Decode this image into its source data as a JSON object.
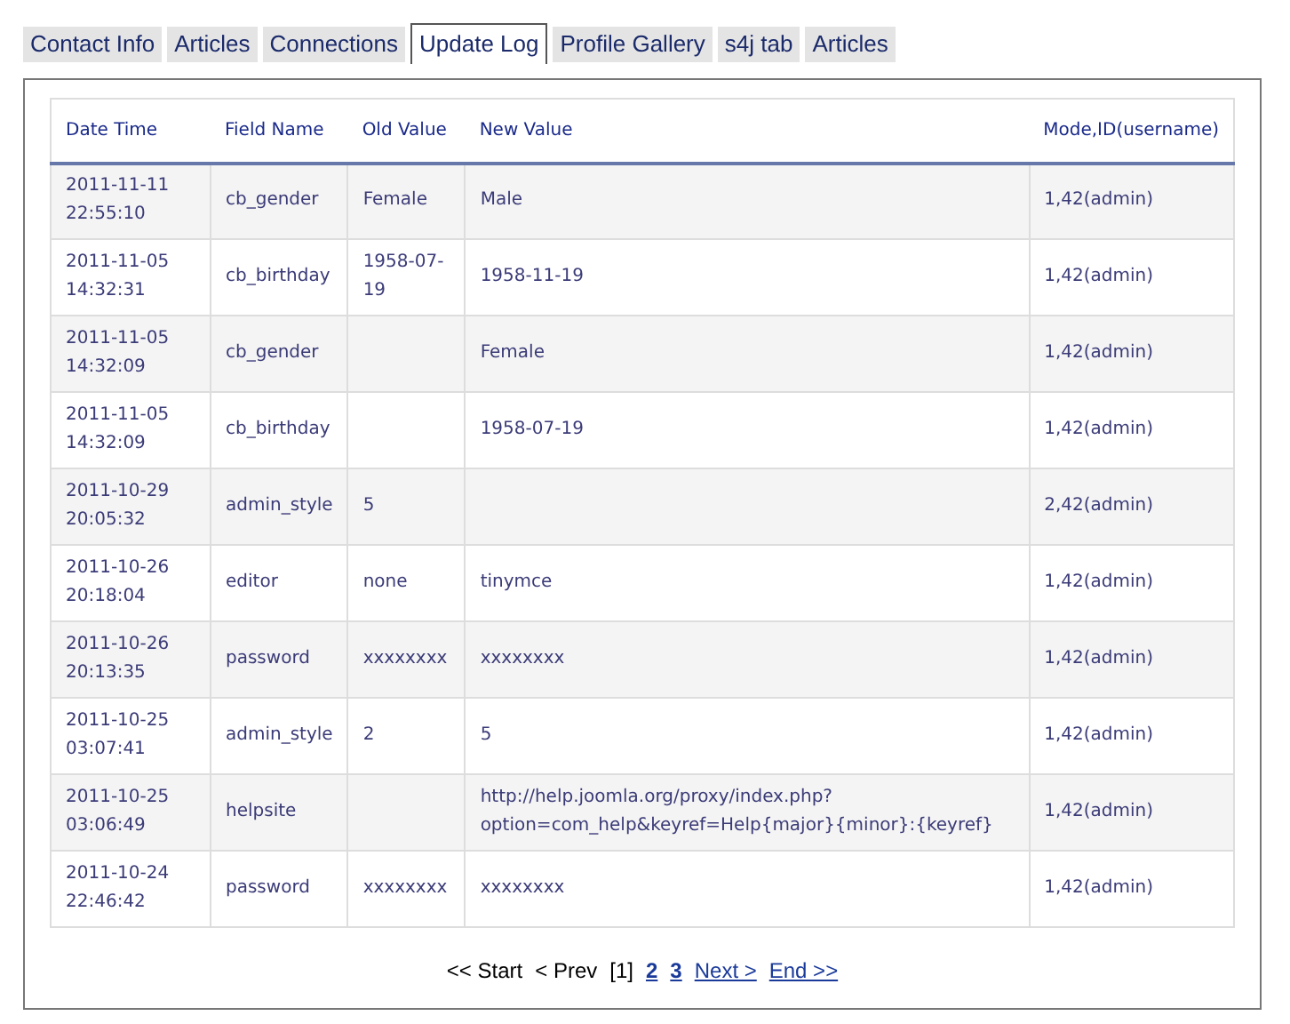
{
  "tabs": [
    {
      "label": "Contact Info",
      "selected": false
    },
    {
      "label": "Articles",
      "selected": false
    },
    {
      "label": "Connections",
      "selected": false
    },
    {
      "label": "Update Log",
      "selected": true
    },
    {
      "label": "Profile Gallery",
      "selected": false
    },
    {
      "label": "s4j tab",
      "selected": false
    },
    {
      "label": "Articles",
      "selected": false
    }
  ],
  "table": {
    "columns": [
      "Date Time",
      "Field Name",
      "Old Value",
      "New Value",
      "Mode,ID(username)"
    ],
    "rows": [
      [
        "2011-11-11 22:55:10",
        "cb_gender",
        "Female",
        "Male",
        "1,42(admin)"
      ],
      [
        "2011-11-05 14:32:31",
        "cb_birthday",
        "1958-07-19",
        "1958-11-19",
        "1,42(admin)"
      ],
      [
        "2011-11-05 14:32:09",
        "cb_gender",
        "",
        "Female",
        "1,42(admin)"
      ],
      [
        "2011-11-05 14:32:09",
        "cb_birthday",
        "",
        "1958-07-19",
        "1,42(admin)"
      ],
      [
        "2011-10-29 20:05:32",
        "admin_style",
        "5",
        "",
        "2,42(admin)"
      ],
      [
        "2011-10-26 20:18:04",
        "editor",
        "none",
        "tinymce",
        "1,42(admin)"
      ],
      [
        "2011-10-26 20:13:35",
        "password",
        "xxxxxxxx",
        "xxxxxxxx",
        "1,42(admin)"
      ],
      [
        "2011-10-25 03:07:41",
        "admin_style",
        "2",
        "5",
        "1,42(admin)"
      ],
      [
        "2011-10-25 03:06:49",
        "helpsite",
        "",
        "http://help.joomla.org/proxy/index.php? option=com_help&keyref=Help{major}{minor}:{keyref}",
        "1,42(admin)"
      ],
      [
        "2011-10-24 22:46:42",
        "password",
        "xxxxxxxx",
        "xxxxxxxx",
        "1,42(admin)"
      ]
    ]
  },
  "pagination": [
    {
      "label": "<< Start",
      "kind": "label"
    },
    {
      "label": "< Prev",
      "kind": "label"
    },
    {
      "label": "[1]",
      "kind": "current"
    },
    {
      "label": "2",
      "kind": "page"
    },
    {
      "label": "3",
      "kind": "page"
    },
    {
      "label": "Next >",
      "kind": "link"
    },
    {
      "label": "End >>",
      "kind": "link"
    }
  ]
}
